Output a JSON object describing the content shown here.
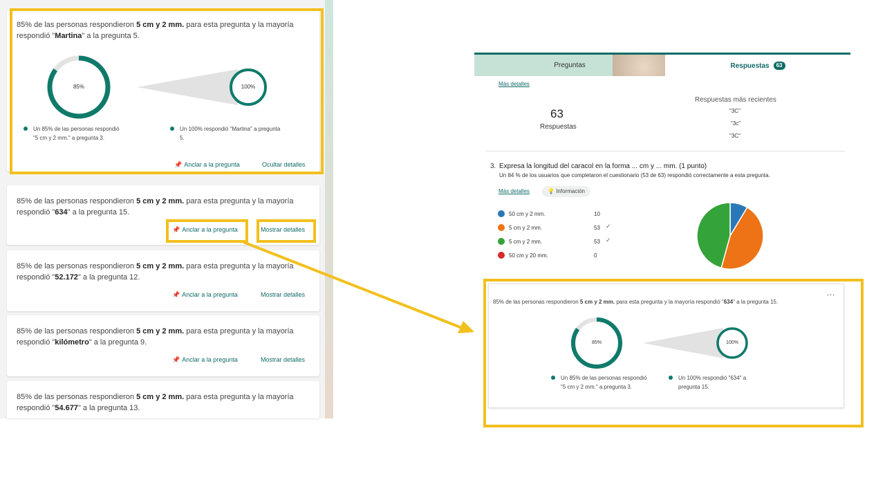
{
  "left": {
    "card1": {
      "text_pre": "85% de las personas respondieron ",
      "text_bold1": "5 cm y 2 mm.",
      "text_mid": " para esta pregunta y la mayoría respondió \"",
      "text_bold2": "Martina",
      "text_post": "\" a la pregunta 5.",
      "ring1_label": "85%",
      "ring2_label": "100%",
      "legend1": "Un 85% de las personas respondió \"5 cm y 2 mm.\" a pregunta 3.",
      "legend2": "Un 100% respondió \"Martina\" a pregunta 5.",
      "pin_label": "Anclar a la pregunta",
      "toggle_label": "Ocultar detalles"
    },
    "card2": {
      "text_pre": "85% de las personas respondieron ",
      "text_bold1": "5 cm y 2 mm.",
      "text_mid": " para esta pregunta y la mayoría respondió \"",
      "text_bold2": "634",
      "text_post": "\" a la pregunta 15.",
      "pin_label": "Anclar a la pregunta",
      "toggle_label": "Mostrar detalles"
    },
    "card3": {
      "text_pre": "85% de las personas respondieron ",
      "text_bold1": "5 cm y 2 mm.",
      "text_mid": " para esta pregunta y la mayoría respondió \"",
      "text_bold2": "52.172",
      "text_post": "\" a la pregunta 12.",
      "pin_label": "Anclar a la pregunta",
      "toggle_label": "Mostrar detalles"
    },
    "card4": {
      "text_pre": "85% de las personas respondieron ",
      "text_bold1": "5 cm y 2 mm.",
      "text_mid": " para esta pregunta y la mayoría respondió \"",
      "text_bold2": "kilómetro",
      "text_post": "\" a la pregunta 9.",
      "pin_label": "Anclar a la pregunta",
      "toggle_label": "Mostrar detalles"
    },
    "card5": {
      "text_pre": "85% de las personas respondieron ",
      "text_bold1": "5 cm y 2 mm.",
      "text_mid": " para esta pregunta y la mayoría respondió \"",
      "text_bold2": "54.677",
      "text_post": "\" a la pregunta 13."
    }
  },
  "right": {
    "tabs": {
      "preguntas": "Preguntas",
      "respuestas": "Respuestas",
      "respuestas_count": "63"
    },
    "mas_detalles": "Más detalles",
    "responses_count": "63",
    "responses_label": "Respuestas",
    "recent_title": "Respuestas más recientes",
    "recent": [
      "\"3C\"",
      "\"3c\"",
      "\"3C\""
    ],
    "question": {
      "number": "3.",
      "text": "Expresa la longitud del caracol en la forma ... cm y ... mm. (1 punto)",
      "summary": "Un 84 % de los usuarios que completaron el cuestionario (53 de 63) respondió correctamente a esta pregunta.",
      "mas_detalles": "Más detalles",
      "info": "Información",
      "options": [
        {
          "label": "50 cm y 2 mm.",
          "count": "10",
          "color": "#2b78b8",
          "correct": false
        },
        {
          "label": "5 cm y 2 mm.",
          "count": "53",
          "color": "#ee7316",
          "correct": true
        },
        {
          "label": "5 cm y 2 mm.",
          "count": "53",
          "color": "#34a33a",
          "correct": true
        },
        {
          "label": "50 cm y 20 mm.",
          "count": "0",
          "color": "#d62b2b",
          "correct": false
        }
      ]
    },
    "insight": {
      "text_pre": "85% de las personas respondieron ",
      "text_bold1": "5 cm y 2 mm.",
      "text_mid": " para esta pregunta y la mayoría respondió \"",
      "text_bold2": "634",
      "text_post": "\" a la pregunta 15.",
      "more": "...",
      "ring1_label": "85%",
      "ring2_label": "100%",
      "legend1": "Un 85% de las personas respondió \"5 cm y 2 mm.\" a pregunta 3.",
      "legend2": "Un 100% respondió \"634\" a pregunta 15."
    }
  },
  "chart_data": {
    "type": "pie",
    "categories": [
      "50 cm y 2 mm.",
      "5 cm y 2 mm.",
      "5 cm y 2 mm.",
      "50 cm y 20 mm."
    ],
    "values": [
      10,
      53,
      53,
      0
    ],
    "colors": [
      "#2b78b8",
      "#ee7316",
      "#34a33a",
      "#d62b2b"
    ]
  },
  "colors": {
    "accent": "#0f6b67",
    "ring": "#0f7a6a",
    "highlight": "#f2c01e"
  }
}
